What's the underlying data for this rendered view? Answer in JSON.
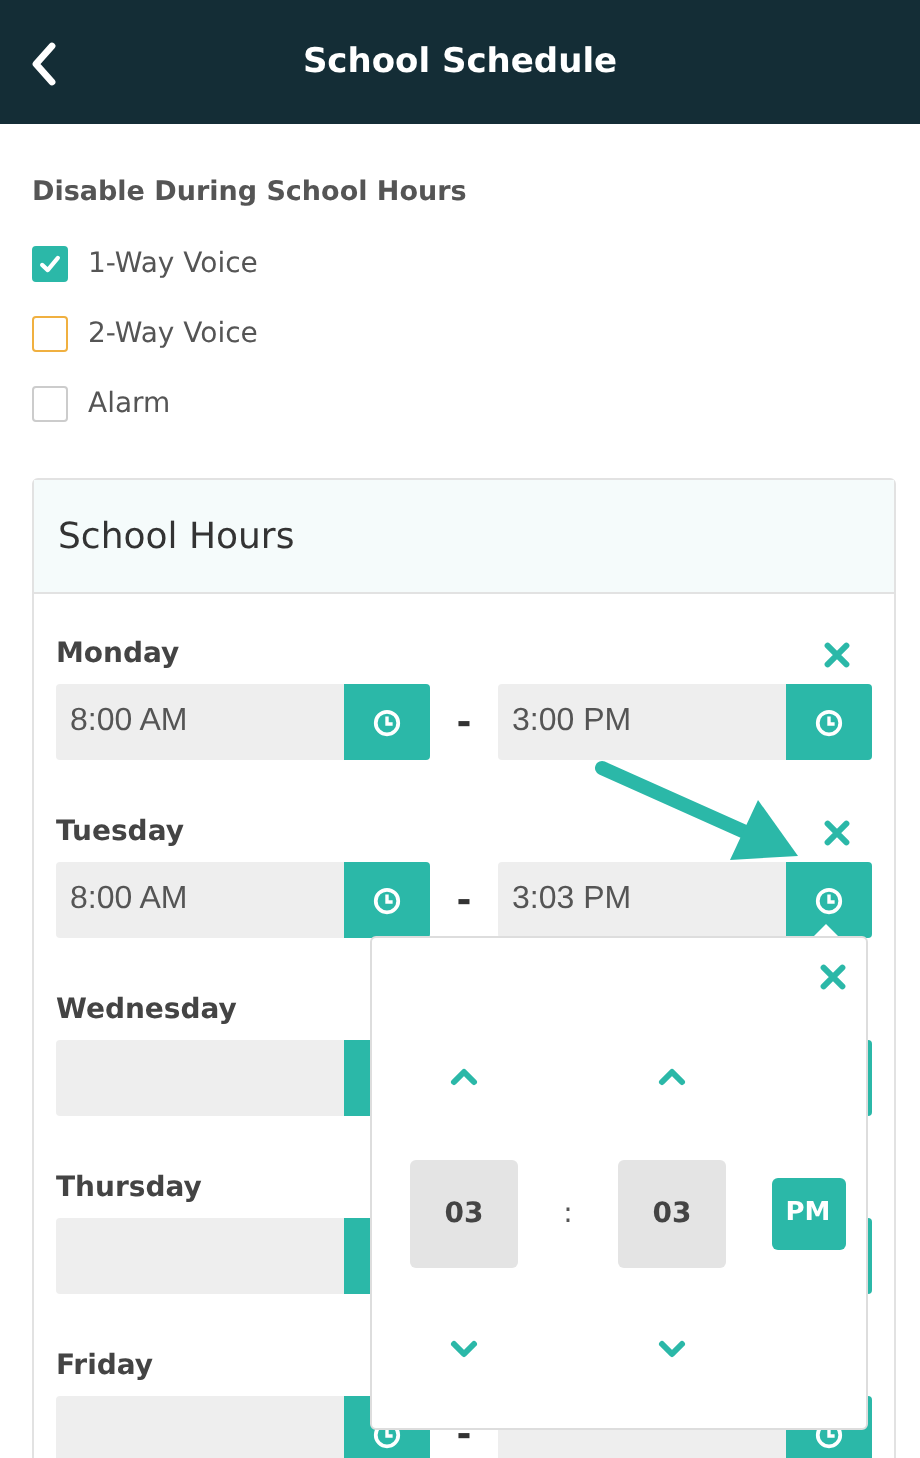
{
  "header": {
    "title": "School Schedule"
  },
  "disable_section": {
    "heading": "Disable During School Hours",
    "options": [
      {
        "label": "1-Way Voice",
        "checked": true,
        "color": "#2bb8a8"
      },
      {
        "label": "2-Way Voice",
        "checked": false,
        "color": "#f0b040"
      },
      {
        "label": "Alarm",
        "checked": false,
        "color": "#cccccc"
      }
    ]
  },
  "school_hours": {
    "title": "School Hours",
    "separator": "-",
    "days": [
      {
        "name": "Monday",
        "start": "8:00 AM",
        "end": "3:00 PM"
      },
      {
        "name": "Tuesday",
        "start": "8:00 AM",
        "end": "3:03 PM"
      },
      {
        "name": "Wednesday"
      },
      {
        "name": "Thursday"
      },
      {
        "name": "Friday"
      }
    ]
  },
  "time_picker": {
    "hour": "03",
    "separator": ":",
    "minute": "03",
    "period": "PM"
  }
}
